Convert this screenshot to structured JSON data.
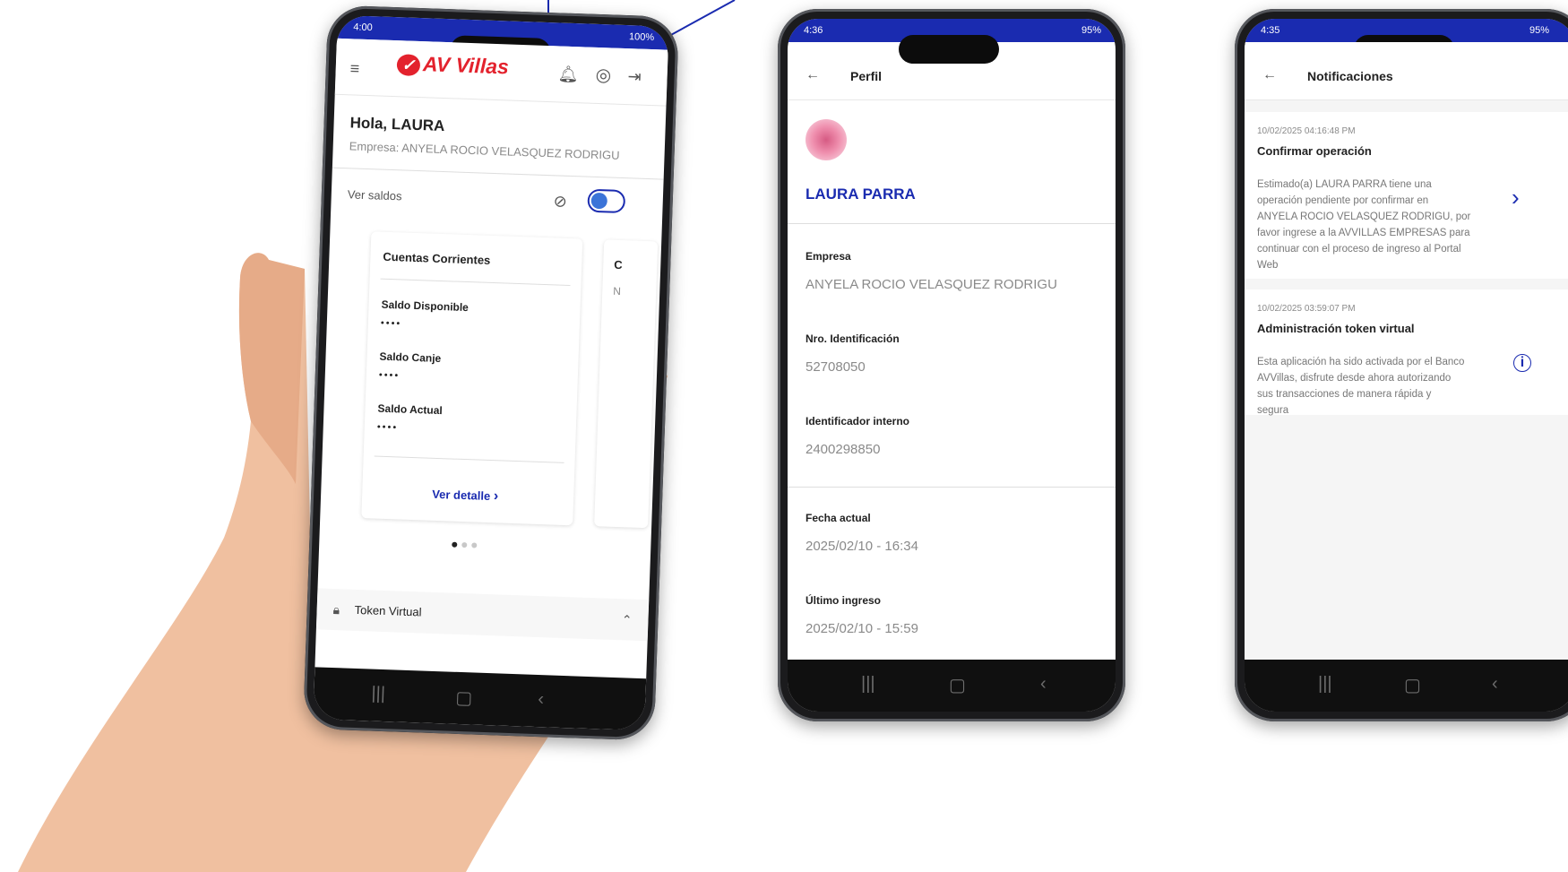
{
  "phone1": {
    "status_time": "4:00",
    "status_right": "100%",
    "brand": "AV Villas",
    "greeting": "Hola, LAURA",
    "company": "Empresa: ANYELA ROCIO VELASQUEZ RODRIGU",
    "ver_saldos": "Ver saldos",
    "card_title": "Cuentas Corrientes",
    "saldo_disponible": "Saldo Disponible",
    "saldo_disponible_val": "••••",
    "saldo_canje": "Saldo Canje",
    "saldo_canje_val": "••••",
    "saldo_actual": "Saldo Actual",
    "saldo_actual_val": "••••",
    "ver_detalle": "Ver detalle",
    "peek_letter_1": "C",
    "peek_letter_2": "N",
    "token_virtual": "Token Virtual"
  },
  "phone2": {
    "status_time": "4:36",
    "status_right": "95%",
    "title": "Perfil",
    "name": "LAURA PARRA",
    "empresa_label": "Empresa",
    "empresa_value": "ANYELA ROCIO VELASQUEZ RODRIGU",
    "id_label": "Nro. Identificación",
    "id_value": "52708050",
    "internal_label": "Identificador interno",
    "internal_value": "2400298850",
    "fecha_label": "Fecha actual",
    "fecha_value": "2025/02/10 - 16:34",
    "ultimo_label": "Último ingreso",
    "ultimo_value": "2025/02/10 - 15:59"
  },
  "phone3": {
    "status_time": "4:35",
    "status_right": "95%",
    "title": "Notificaciones",
    "n1_time": "10/02/2025 04:16:48 PM",
    "n1_title": "Confirmar operación",
    "n1_body": [
      "Estimado(a) LAURA PARRA tiene una",
      "operación pendiente por confirmar en",
      "ANYELA ROCIO VELASQUEZ RODRIGU, por",
      "favor ingrese a la AVVILLAS EMPRESAS para",
      "continuar con el proceso de ingreso al Portal",
      "Web"
    ],
    "n2_time": "10/02/2025 03:59:07 PM",
    "n2_title": "Administración token virtual",
    "n2_body": [
      "Esta aplicación ha sido activada por el Banco",
      "AVVillas, disfrute desde ahora autorizando",
      "sus transacciones de manera rápida y",
      "segura"
    ]
  },
  "colors": {
    "brand_red": "#e3222d",
    "brand_blue": "#1a2bb0",
    "annotation_arrow": "#1a2bb0"
  },
  "icons": [
    "menu-icon",
    "bell-icon",
    "user-icon",
    "logout-icon",
    "eye-off-icon",
    "chevron-right-icon",
    "lock-icon",
    "chevron-up-icon",
    "back-arrow-icon",
    "info-icon"
  ]
}
